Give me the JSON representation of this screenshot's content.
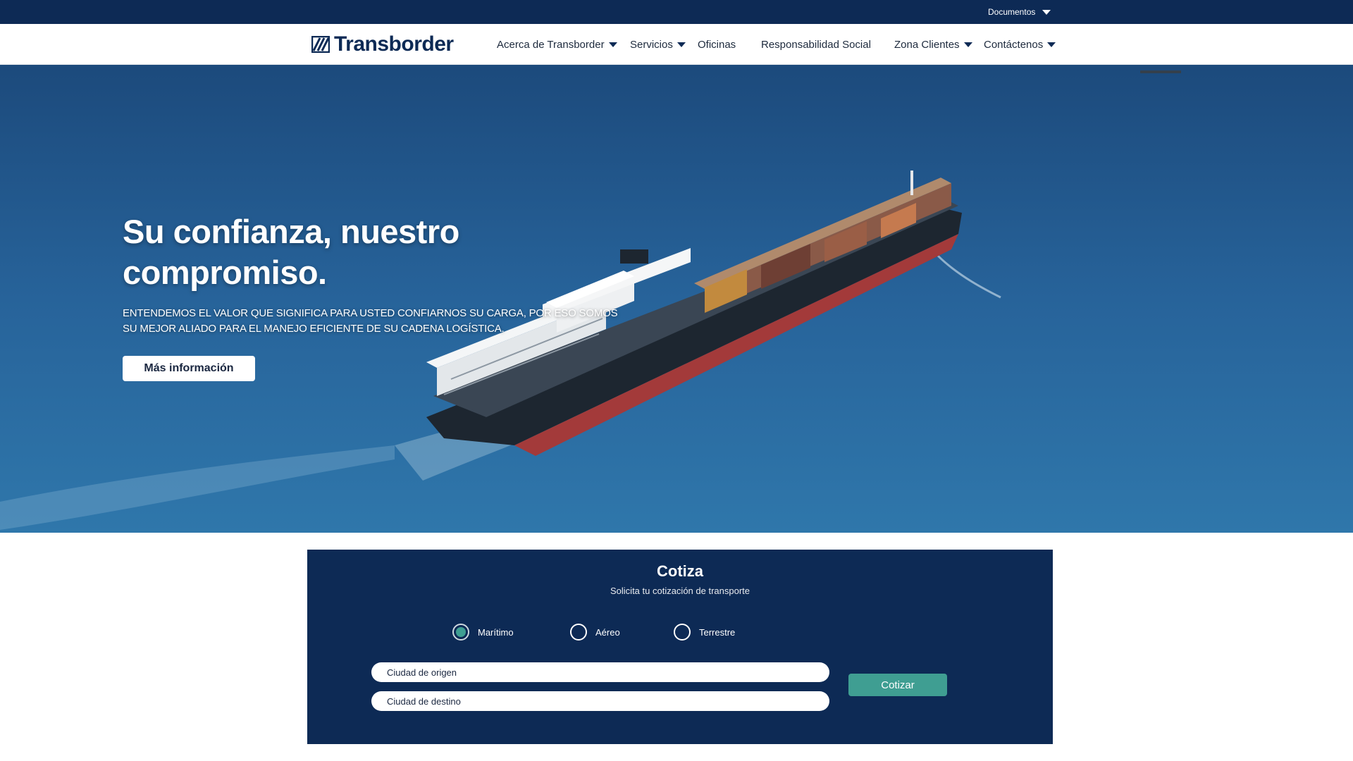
{
  "topbar": {
    "documents_label": "Documentos"
  },
  "brand": {
    "name": "Transborder",
    "color": "#0d2a55"
  },
  "nav": {
    "items": [
      {
        "label": "Acerca de Transborder",
        "has_dropdown": true
      },
      {
        "label": "Servicios",
        "has_dropdown": true
      },
      {
        "label": "Oficinas",
        "has_dropdown": false
      },
      {
        "label": "Responsabilidad Social",
        "has_dropdown": false
      },
      {
        "label": "Zona Clientes",
        "has_dropdown": true
      },
      {
        "label": "Contáctenos",
        "has_dropdown": true
      }
    ]
  },
  "hero": {
    "title": "Su confianza, nuestro compromiso.",
    "subtitle": "Entendemos el valor que significa para usted confiarnos su carga, por eso somos su mejor aliado para el manejo eficiente de su cadena logística.",
    "button_label": "Más información"
  },
  "quote": {
    "title": "Cotiza",
    "subtitle": "Solicita tu cotización de transporte",
    "options": [
      {
        "label": "Marítimo",
        "selected": true
      },
      {
        "label": "Aéreo",
        "selected": false
      },
      {
        "label": "Terrestre",
        "selected": false
      }
    ],
    "origin_placeholder": "Ciudad de origen",
    "destination_placeholder": "Ciudad de destino",
    "submit_label": "Cotizar",
    "accent_color": "#3f9e92"
  }
}
